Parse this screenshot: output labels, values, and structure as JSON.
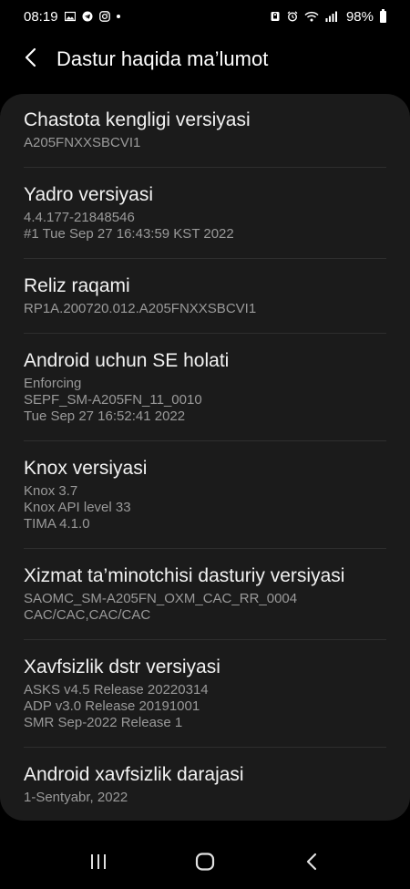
{
  "status_bar": {
    "time": "08:19",
    "battery_text": "98%",
    "left_icons": [
      "image-icon",
      "telegram-icon",
      "instagram-icon",
      "notification-dot-icon"
    ],
    "right_icons": [
      "alarm-lock-icon",
      "alarm-clock-icon",
      "wifi-icon",
      "signal-icon",
      "battery-icon"
    ]
  },
  "header": {
    "title": "Dastur haqida ma’lumot",
    "back_icon": "chevron-left-icon"
  },
  "items": [
    {
      "title": "Chastota kengligi versiyasi",
      "lines": [
        "A205FNXXSBCVI1"
      ]
    },
    {
      "title": "Yadro versiyasi",
      "lines": [
        "4.4.177-21848546",
        "#1 Tue Sep 27 16:43:59 KST 2022"
      ]
    },
    {
      "title": "Reliz raqami",
      "lines": [
        "RP1A.200720.012.A205FNXXSBCVI1"
      ]
    },
    {
      "title": "Android uchun SE holati",
      "lines": [
        "Enforcing",
        "SEPF_SM-A205FN_11_0010",
        "Tue Sep 27 16:52:41 2022"
      ]
    },
    {
      "title": "Knox versiyasi",
      "lines": [
        "Knox 3.7",
        "Knox API level 33",
        "TIMA 4.1.0"
      ]
    },
    {
      "title": "Xizmat ta’minotchisi dasturiy versiyasi",
      "lines": [
        "SAOMC_SM-A205FN_OXM_CAC_RR_0004",
        "CAC/CAC,CAC/CAC"
      ]
    },
    {
      "title": "Xavfsizlik dstr versiyasi",
      "lines": [
        "ASKS v4.5 Release 20220314",
        "ADP v3.0 Release 20191001",
        "SMR Sep-2022 Release 1"
      ]
    },
    {
      "title": "Android xavfsizlik darajasi",
      "lines": [
        "1-Sentyabr, 2022"
      ]
    }
  ],
  "nav_bar": {
    "icons": [
      "recent-apps-icon",
      "home-icon",
      "back-icon"
    ]
  },
  "colors": {
    "background": "#000000",
    "card": "#1b1b1b",
    "title_text": "#f2f2f2",
    "secondary_text": "#9a9a9a"
  }
}
